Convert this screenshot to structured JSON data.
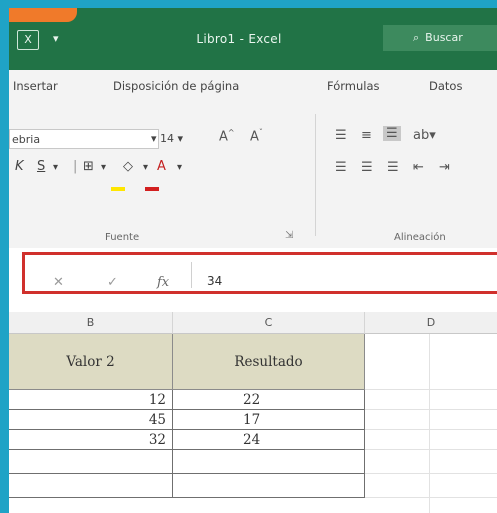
{
  "window": {
    "title": "Libro1 - Excel",
    "tell_me_label": "Buscar"
  },
  "ribbon_tabs": [
    "Insertar",
    "Disposición de página",
    "Fórmulas",
    "Datos"
  ],
  "font_group": {
    "font_name": "ebria",
    "font_size": "14",
    "label": "Fuente"
  },
  "alignment_group": {
    "label": "Alineación"
  },
  "formula_bar": {
    "value": "34"
  },
  "columns": [
    "B",
    "C",
    "D"
  ],
  "table": {
    "headers": [
      "Valor 2",
      "Resultado"
    ],
    "rows": [
      {
        "valor2": "12",
        "resultado": "22"
      },
      {
        "valor2": "45",
        "resultado": "17"
      },
      {
        "valor2": "32",
        "resultado": "24"
      },
      {
        "valor2": "",
        "resultado": ""
      },
      {
        "valor2": "",
        "resultado": ""
      }
    ]
  },
  "colors": {
    "excel_green": "#217346",
    "page_background": "#1fa3c6",
    "header_fill": "#dddbc3",
    "highlight_red": "#d0302c",
    "accent_orange": "#f07a2a"
  },
  "icons": [
    "excel-icon",
    "quick-access-icon",
    "search-icon",
    "grow-font-icon",
    "shrink-font-icon",
    "italic-icon",
    "underline-icon",
    "borders-icon",
    "fill-color-icon",
    "font-color-icon",
    "align-top-icon",
    "align-middle-icon",
    "align-bottom-icon",
    "orientation-icon",
    "align-left-icon",
    "align-center-icon",
    "align-right-icon",
    "decrease-indent-icon",
    "increase-indent-icon",
    "cancel-icon",
    "enter-icon",
    "function-icon",
    "dialog-launcher-icon"
  ]
}
